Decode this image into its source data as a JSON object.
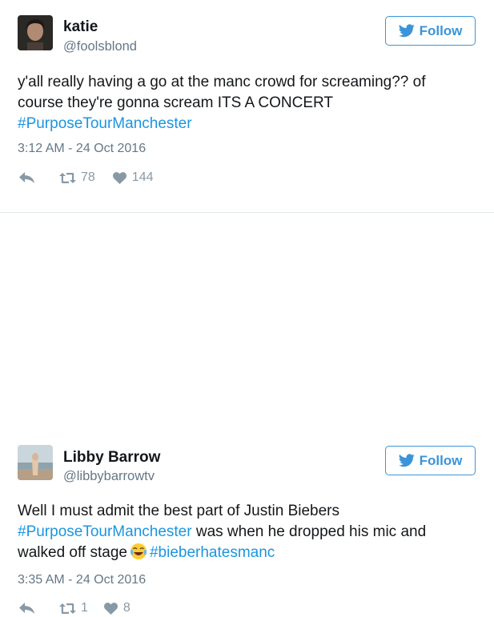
{
  "tweets": [
    {
      "name": "katie",
      "handle": "@foolsblond",
      "follow_label": "Follow",
      "text_lines": [
        [
          "y'all really having a go at the manc crowd for screaming?? of"
        ],
        [
          "course they're gonna scream ITS A CONCERT"
        ]
      ],
      "hashtag_line": "#PurposeTourManchester",
      "timestamp": "3:12 AM - 24 Oct 2016",
      "retweets": "78",
      "likes": "144"
    },
    {
      "name": "Libby Barrow",
      "handle": "@libbybarrowtv",
      "follow_label": "Follow",
      "line1": "Well I must admit the best part of Justin Biebers",
      "line2_hashtag": "#PurposeTourManchester",
      "line2_rest": " was when he dropped his mic and",
      "line3_text": "walked off stage",
      "line3_hashtag": "#bieberhatesmanc",
      "emoji": "face-with-tears-of-joy",
      "timestamp": "3:35 AM - 24 Oct 2016",
      "retweets": "1",
      "likes": "8"
    }
  ],
  "colors": {
    "link": "#1b95e0",
    "follow": "#3b94d9",
    "muted": "#657786",
    "icon": "#8899a6",
    "divider": "#e1e8ed"
  },
  "icons": [
    "twitter-bird-icon",
    "reply-icon",
    "retweet-icon",
    "heart-icon"
  ]
}
